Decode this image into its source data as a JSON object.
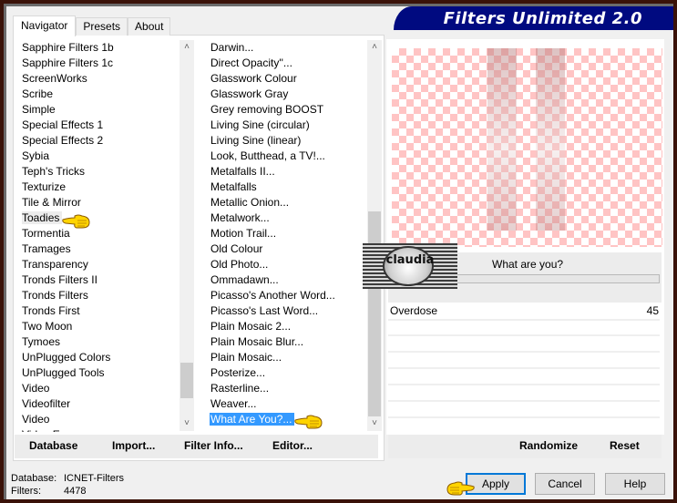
{
  "banner": {
    "title": "Filters Unlimited 2.0",
    "color": "#000a80"
  },
  "tabs": [
    {
      "label": "Navigator",
      "active": true
    },
    {
      "label": "Presets",
      "active": false
    },
    {
      "label": "About",
      "active": false
    }
  ],
  "categories": {
    "items": [
      "Sapphire Filters 1b",
      "Sapphire Filters 1c",
      "ScreenWorks",
      "Scribe",
      "Simple",
      "Special Effects 1",
      "Special Effects 2",
      "Sybia",
      "Teph's Tricks",
      "Texturize",
      "Tile & Mirror",
      "Toadies",
      "Tormentia",
      "Tramages",
      "Transparency",
      "Tronds Filters II",
      "Tronds Filters",
      "Tronds First",
      "Two Moon",
      "Tymoes",
      "UnPlugged Colors",
      "UnPlugged Tools",
      "Video",
      "Videofilter",
      "Video",
      "Video Ex"
    ],
    "highlighted": "Toadies"
  },
  "filters": {
    "items": [
      "Darwin...",
      "Direct Opacity''...",
      "Glasswork Colour",
      "Glasswork Gray",
      "Grey removing BOOST",
      "Living Sine (circular)",
      "Living Sine (linear)",
      "Look, Butthead, a TV!...",
      "Metalfalls II...",
      "Metalfalls",
      "Metallic Onion...",
      "Metalwork...",
      "Motion Trail...",
      "Old Colour",
      "Old Photo...",
      "Ommadawn...",
      "Picasso's Another Word...",
      "Picasso's Last Word...",
      "Plain Mosaic 2...",
      "Plain Mosaic Blur...",
      "Plain Mosaic...",
      "Posterize...",
      "Rasterline...",
      "Weaver...",
      "What Are You?..."
    ],
    "selected": "What Are You?...",
    "selection_color": "#3399ff"
  },
  "left_buttons": {
    "database": "Database",
    "import": "Import...",
    "filter_info": "Filter Info...",
    "editor": "Editor..."
  },
  "preview": {
    "filter_title": "What are you?",
    "watermark": "claudia"
  },
  "parameters": [
    {
      "label": "Overdose",
      "value": "45"
    }
  ],
  "right_buttons": {
    "randomize": "Randomize",
    "reset": "Reset"
  },
  "status": {
    "database_label": "Database:",
    "database_value": "ICNET-Filters",
    "filters_label": "Filters:",
    "filters_value": "4478"
  },
  "dialog_buttons": {
    "apply": "Apply",
    "cancel": "Cancel",
    "help": "Help"
  }
}
